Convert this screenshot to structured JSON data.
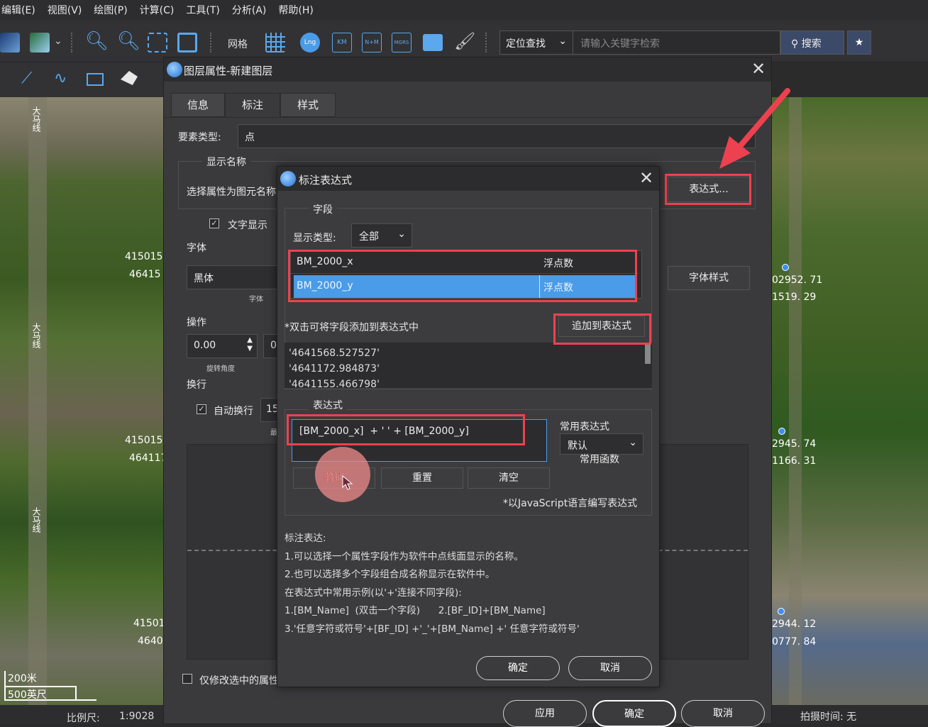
{
  "menu": [
    "编辑(E)",
    "视图(V)",
    "绘图(P)",
    "计算(C)",
    "工具(T)",
    "分析(A)",
    "帮助(H)"
  ],
  "toolbar": {
    "grid_label": "网格",
    "icon_labels": [
      "Lng",
      "KM",
      "N+M",
      "MGRS"
    ],
    "locate_combo": "定位查找",
    "search_placeholder": "请输入关键字检索",
    "search_button": "搜索"
  },
  "map": {
    "road_label": "大马线",
    "coords_left": [
      "415015",
      "46415",
      "415015",
      "464117",
      "41501",
      "4640"
    ],
    "coords_right": [
      "02952. 71",
      "1519. 29",
      "2945. 74",
      "1166. 31",
      "2944. 12",
      "0777. 84"
    ],
    "scale_m": "200米",
    "scale_ft": "500英尺"
  },
  "status": {
    "scale_label": "比例尺:",
    "scale_value": "1:9028",
    "capture_label": "拍摄时间: 无"
  },
  "layer_dialog": {
    "title": "图层属性-新建图层",
    "tabs": [
      "信息",
      "标注",
      "样式"
    ],
    "feature_type_label": "要素类型:",
    "feature_type_value": "点",
    "display_name_group": "显示名称",
    "select_attr_label": "选择属性为图元名称",
    "expression_button": "表达式...",
    "text_display_label": "文字显示",
    "font_label": "字体",
    "font_value": "黑体",
    "font_caption": "字体",
    "font_style_button": "字体样式",
    "operation_label": "操作",
    "rotation_value": "0.00",
    "rotation_caption": "旋转角度",
    "second_value": "0",
    "wrap_label": "换行",
    "auto_wrap_label": "自动换行",
    "wrap_value": "15",
    "wrap_caption": "最",
    "only_selected_label": "仅修改选中的属性",
    "apply_button": "应用",
    "ok_button": "确定",
    "cancel_button": "取消"
  },
  "expr_dialog": {
    "title": "标注表达式",
    "field_group": "字段",
    "display_type_label": "显示类型:",
    "display_type_value": "全部",
    "fields": [
      {
        "name": "BM_2000_x",
        "type": "浮点数"
      },
      {
        "name": "BM_2000_y",
        "type": "浮点数"
      }
    ],
    "hint": "*双击可将字段添加到表达式中",
    "append_button": "追加到表达式",
    "values": [
      "'4641568.527527'",
      "'4641172.984873'",
      "'4641155.466798'"
    ],
    "expr_group": "表达式",
    "expression": "[BM_2000_x]  + ' ' + [BM_2000_y]",
    "common_expr_label": "常用表达式",
    "common_expr_value": "默认",
    "common_func_label": "常用函数",
    "validate_button": "验证",
    "reset_button": "重置",
    "clear_button": "清空",
    "js_note": "*以JavaScript语言编写表达式",
    "notes": [
      "标注表达:",
      "1.可以选择一个属性字段作为软件中点线面显示的名称。",
      "2.也可以选择多个字段组合成名称显示在软件中。",
      "在表达式中常用示例(以'+'连接不同字段):",
      "1.[BM_Name]  (双击一个字段)      2.[BF_ID]+[BM_Name]",
      "3.'任意字符或符号'+[BF_ID] +'_'+[BM_Name] +' 任意字符或符号'"
    ],
    "ok_button": "确定",
    "cancel_button": "取消"
  },
  "colors": {
    "highlight": "#ee4150",
    "selected_row": "#4a9be8",
    "cursor_circle": "#f08a8a"
  }
}
